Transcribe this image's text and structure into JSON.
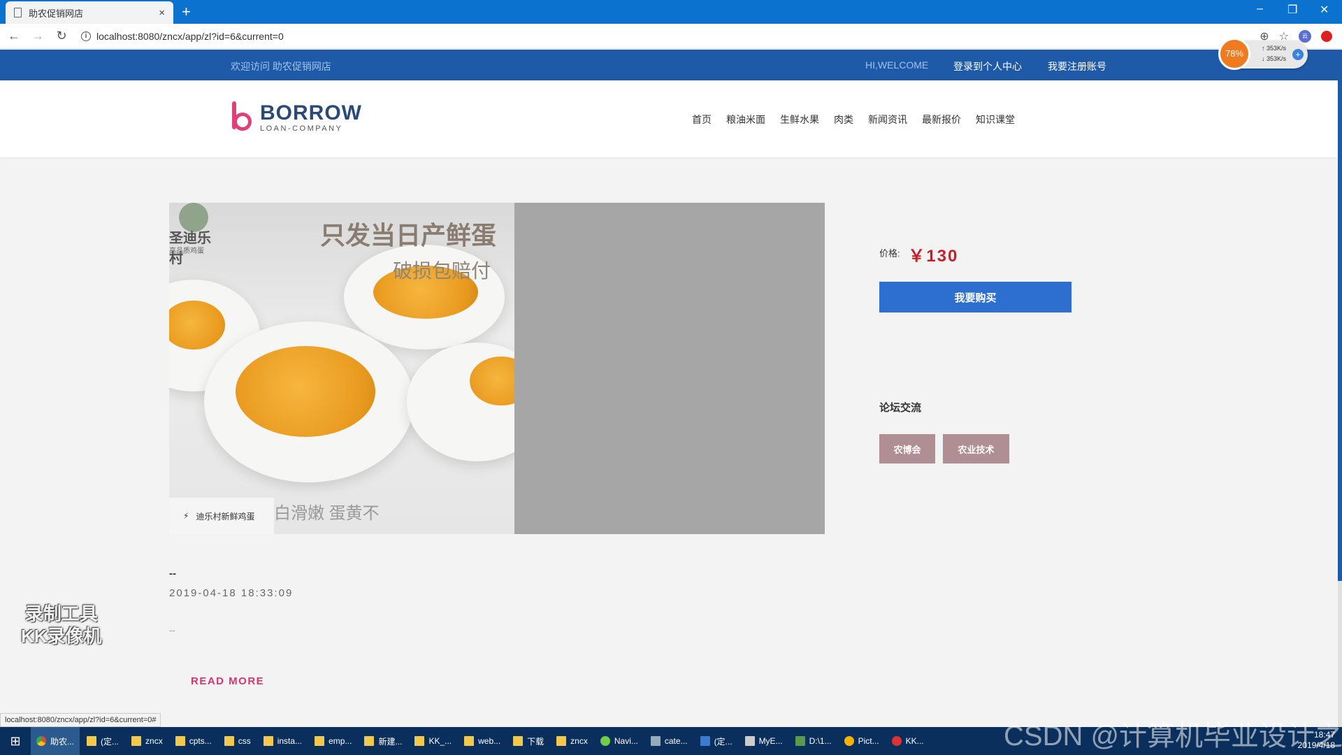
{
  "browser": {
    "tab_title": "助农促销网店",
    "tab_close": "×",
    "new_tab": "+",
    "url": "localhost:8080/zncx/app/zl?id=6&current=0",
    "status_url": "localhost:8080/zncx/app/zl?id=6&current=0#"
  },
  "speed_widget": {
    "percent": "78%",
    "up": "353K/s",
    "down": "353K/s"
  },
  "topbar": {
    "welcome": "欢迎访问 助农促销网店",
    "hi": "HI,WELCOME",
    "login": "登录到个人中心",
    "register": "我要注册账号"
  },
  "logo": {
    "name": "BORROW",
    "tagline": "LOAN-COMPANY"
  },
  "nav": [
    "首页",
    "粮油米面",
    "生鲜水果",
    "肉类",
    "新闻资讯",
    "最新报价",
    "知识课堂"
  ],
  "hero": {
    "brand_name": "圣迪乐村",
    "brand_sub": "高品质鸡蛋",
    "headline": "只发当日产鲜蛋",
    "subline": "破损包赔付",
    "caption": "迪乐村新鲜鸡蛋",
    "bottom_text": "白滑嫩 蛋黄不"
  },
  "article": {
    "title": "--",
    "date": "2019-04-18 18:33:09",
    "summary": "--",
    "read_more": "READ MORE"
  },
  "sidebar": {
    "price_label": "价格:",
    "price_value": "￥130",
    "buy_button": "我要购买",
    "forum_title": "论坛交流",
    "tags": [
      "农博会",
      "农业技术"
    ]
  },
  "watermark": {
    "line1": "录制工具",
    "line2": "KK录像机"
  },
  "taskbar": {
    "items": [
      "助农...",
      "(定...",
      "zncx",
      "cpts...",
      "css",
      "insta...",
      "emp...",
      "新建...",
      "KK_...",
      "web...",
      "下载",
      "zncx",
      "Navi...",
      "cate...",
      "(定...",
      "MyE...",
      "D:\\1...",
      "Pict...",
      "KK..."
    ],
    "time": "18:47",
    "date": "2019/4/18"
  },
  "overlay_text": "CSDN @计算机毕业设计之家",
  "colors": {
    "topbar": "#1e5aa8",
    "buy_button": "#2d6fce",
    "price": "#c81e2a",
    "read_more": "#d6356f",
    "tag_bg": "#b08f94"
  }
}
